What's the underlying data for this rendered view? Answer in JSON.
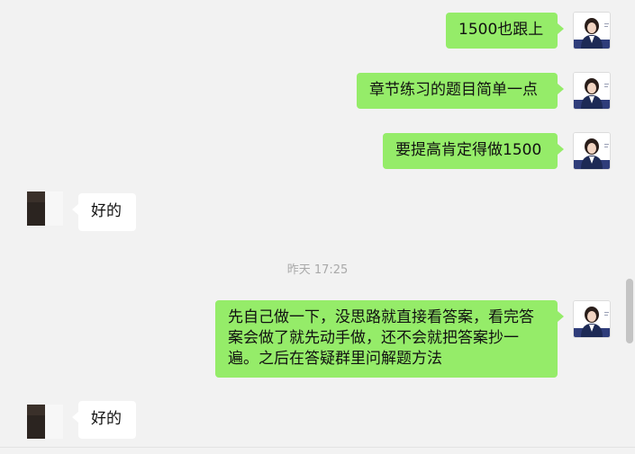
{
  "messages": [
    {
      "sender": "self",
      "text": "1500也跟上"
    },
    {
      "sender": "self",
      "text": "章节练习的题目简单一点"
    },
    {
      "sender": "self",
      "text": "要提高肯定得做1500"
    },
    {
      "sender": "other",
      "text": "好的"
    },
    {
      "sender": "self",
      "text": "先自己做一下，没思路就直接看答案，看完答案会做了就先动手做，还不会就把答案抄一遍。之后在答疑群里问解题方法"
    },
    {
      "sender": "other",
      "text": "好的"
    }
  ],
  "timestamp": "昨天 17:25",
  "colors": {
    "outgoing_bubble": "#95ec69",
    "incoming_bubble": "#ffffff",
    "background": "#f2f2f2",
    "avatar_frame": "#2f3d7a"
  }
}
